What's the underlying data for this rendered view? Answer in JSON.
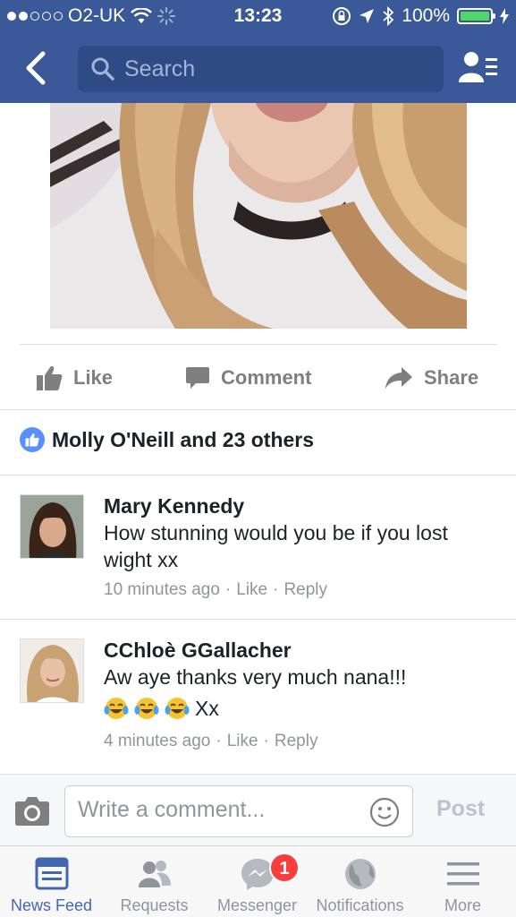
{
  "status_bar": {
    "carrier": "O2-UK",
    "time": "13:23",
    "battery": "100%"
  },
  "nav": {
    "search_placeholder": "Search"
  },
  "post": {
    "actions": {
      "like": "Like",
      "comment": "Comment",
      "share": "Share"
    },
    "likes_summary": "Molly O'Neill and 23 others"
  },
  "comments": [
    {
      "author": "Mary Kennedy",
      "text": "How stunning would you be if you lost wight xx",
      "time": "10 minutes ago",
      "like": "Like",
      "reply": "Reply"
    },
    {
      "author": "CChloè GGallacher",
      "text": "Aw aye thanks very much nana!!!",
      "emoji_text": "Xx",
      "emoji": [
        "face-with-tears-of-joy",
        "face-with-tears-of-joy",
        "face-with-tears-of-joy"
      ],
      "time": "4 minutes ago",
      "like": "Like",
      "reply": "Reply"
    }
  ],
  "composer": {
    "placeholder": "Write a comment...",
    "post_label": "Post"
  },
  "tabbar": {
    "items": [
      {
        "label": "News Feed",
        "icon": "news-feed-icon",
        "active": true
      },
      {
        "label": "Requests",
        "icon": "requests-icon"
      },
      {
        "label": "Messenger",
        "icon": "messenger-icon",
        "badge": "1"
      },
      {
        "label": "Notifications",
        "icon": "globe-icon"
      },
      {
        "label": "More",
        "icon": "menu-icon"
      }
    ]
  },
  "colors": {
    "brand": "#3b5998",
    "link_active": "#4267b2",
    "badge": "#fa3e3e",
    "battery": "#4cd964"
  }
}
